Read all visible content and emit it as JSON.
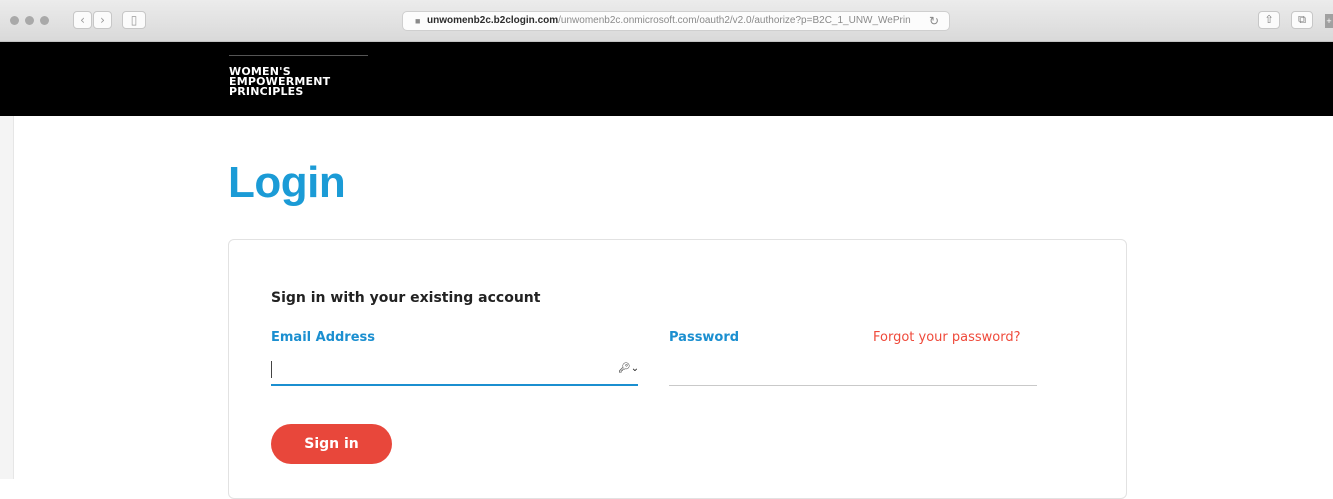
{
  "browser": {
    "url_host": "unwomenb2c.b2clogin.com",
    "url_path": "/unwomenb2c.onmicrosoft.com/oauth2/v2.0/authorize?p=B2C_1_UNW_WePrin",
    "icons": {
      "back": "‹",
      "forward": "›",
      "sidebar": "▯",
      "lock": "🔒",
      "reload": "↻",
      "share": "⇧",
      "tabs": "⧉"
    }
  },
  "site": {
    "brand_lines": [
      "WOMEN'S",
      "EMPOWERMENT",
      "PRINCIPLES"
    ]
  },
  "page": {
    "title": "Login"
  },
  "form": {
    "heading": "Sign in with your existing account",
    "email_label": "Email Address",
    "email_value": "",
    "password_label": "Password",
    "password_value": "",
    "forgot_link": "Forgot your password?",
    "submit_label": "Sign in",
    "key_icon": "🔑︎⌄"
  },
  "colors": {
    "accent_blue": "#1b9bd6",
    "link_red": "#ef4a3b",
    "button_red": "#e8473b",
    "header_black": "#000000"
  }
}
